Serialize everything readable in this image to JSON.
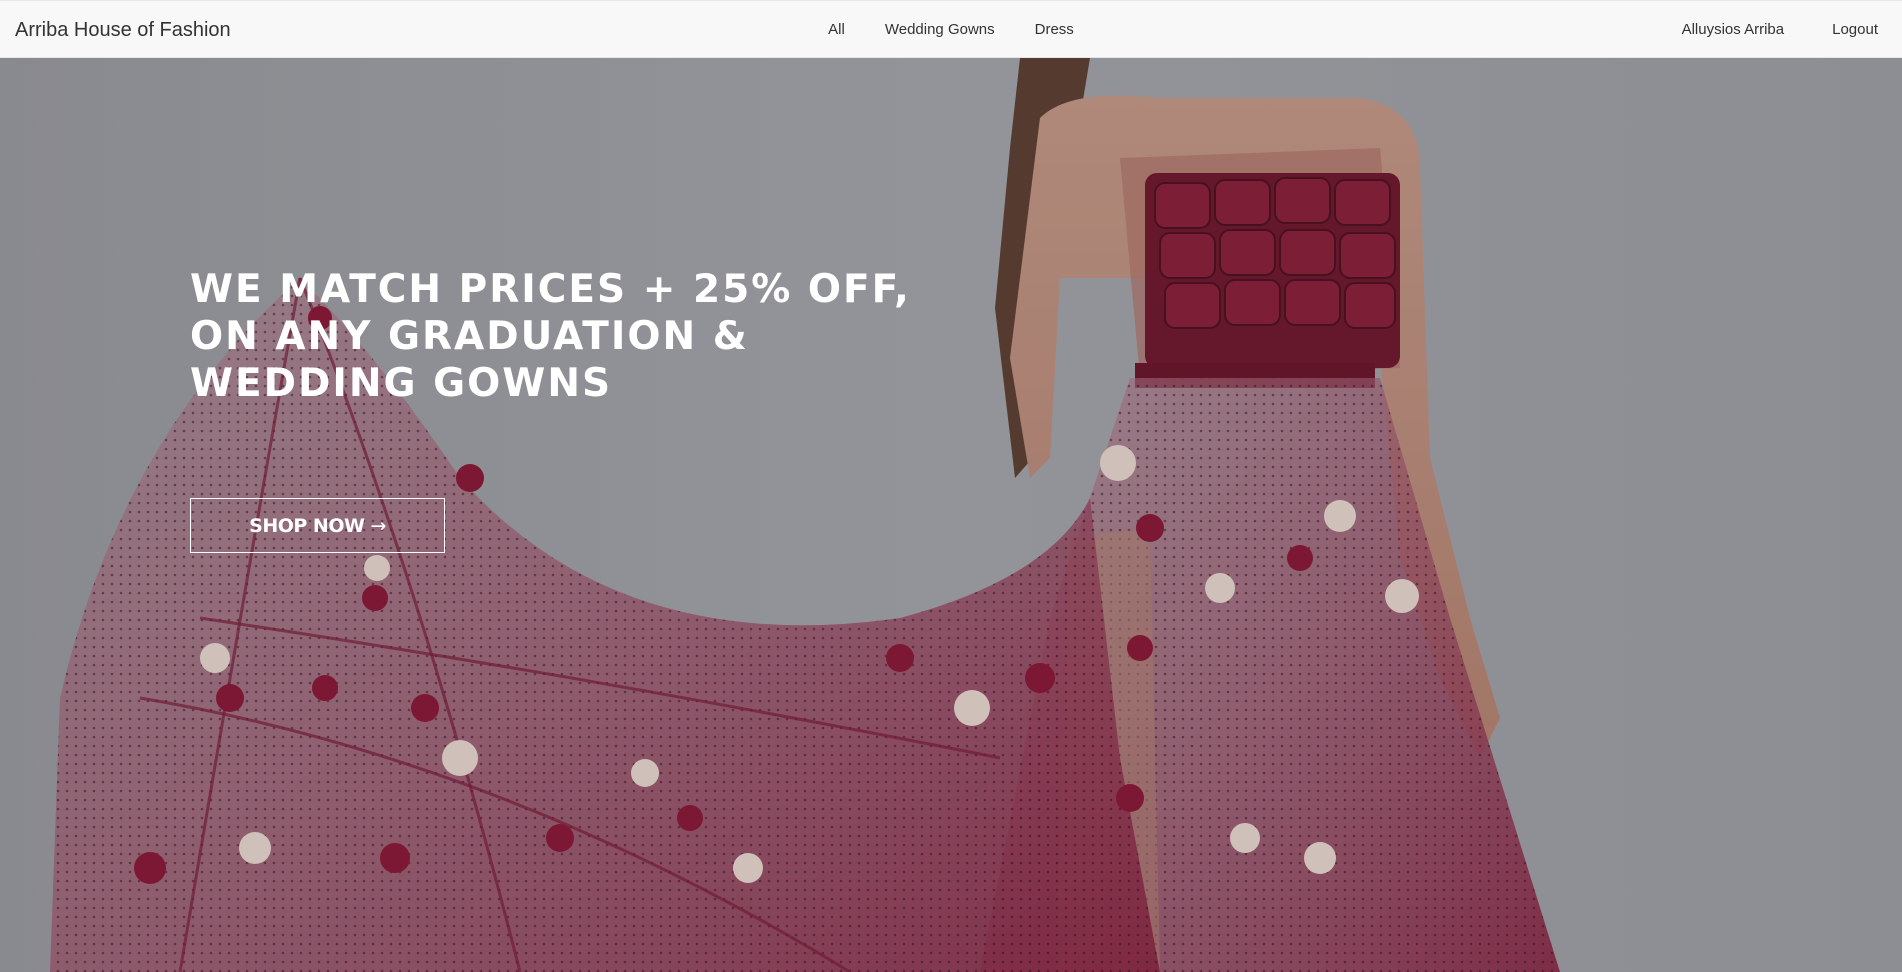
{
  "navbar": {
    "brand": "Arriba House of Fashion",
    "links": [
      "All",
      "Wedding Gowns",
      "Dress"
    ],
    "user_name": "Alluysios Arriba",
    "logout_label": "Logout"
  },
  "hero": {
    "headline": "WE MATCH PRICES + 25% OFF,\nON ANY GRADUATION &\nWEDDING GOWNS",
    "cta_label": "SHOP NOW",
    "cta_icon": "arrow-right-icon",
    "cta_arrow": "→"
  },
  "colors": {
    "navbar_bg": "#f8f8f8",
    "hero_text": "#ffffff",
    "dress_burgundy": "#7a1530",
    "backdrop_gray": "#a2a4a8"
  }
}
